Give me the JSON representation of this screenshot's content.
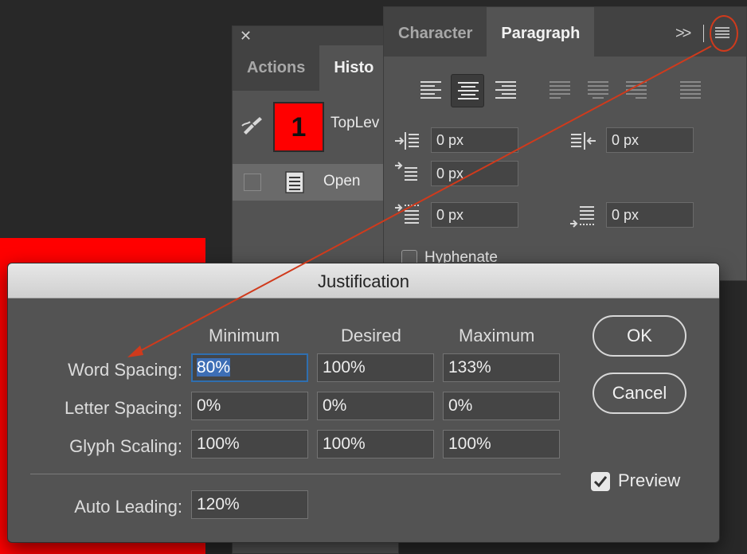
{
  "history_panel": {
    "close_glyph": "✕",
    "tabs": [
      "Actions",
      "Histo"
    ],
    "snapshot": {
      "thumb_text": "1",
      "name": "TopLev"
    },
    "state": {
      "name": "Open"
    }
  },
  "paragraph_panel": {
    "tabs": [
      "Character",
      "Paragraph"
    ],
    "expand_glyph": ">>",
    "indent_left": "0 px",
    "indent_right": "0 px",
    "indent_first": "0 px",
    "space_before": "0 px",
    "space_after": "0 px",
    "hyphenate_label": "Hyphenate"
  },
  "dialog": {
    "title": "Justification",
    "columns": [
      "Minimum",
      "Desired",
      "Maximum"
    ],
    "rows": [
      {
        "label": "Word Spacing:",
        "values": [
          "80%",
          "100%",
          "133%"
        ]
      },
      {
        "label": "Letter Spacing:",
        "values": [
          "0%",
          "0%",
          "0%"
        ]
      },
      {
        "label": "Glyph Scaling:",
        "values": [
          "100%",
          "100%",
          "100%"
        ]
      }
    ],
    "auto_leading_label": "Auto Leading:",
    "auto_leading_value": "120%",
    "ok_label": "OK",
    "cancel_label": "Cancel",
    "preview_label": "Preview",
    "preview_checked": true
  },
  "colors": {
    "annotation": "#d03a1c",
    "canvas": "#ff0000",
    "focus": "#3d6eb5"
  }
}
